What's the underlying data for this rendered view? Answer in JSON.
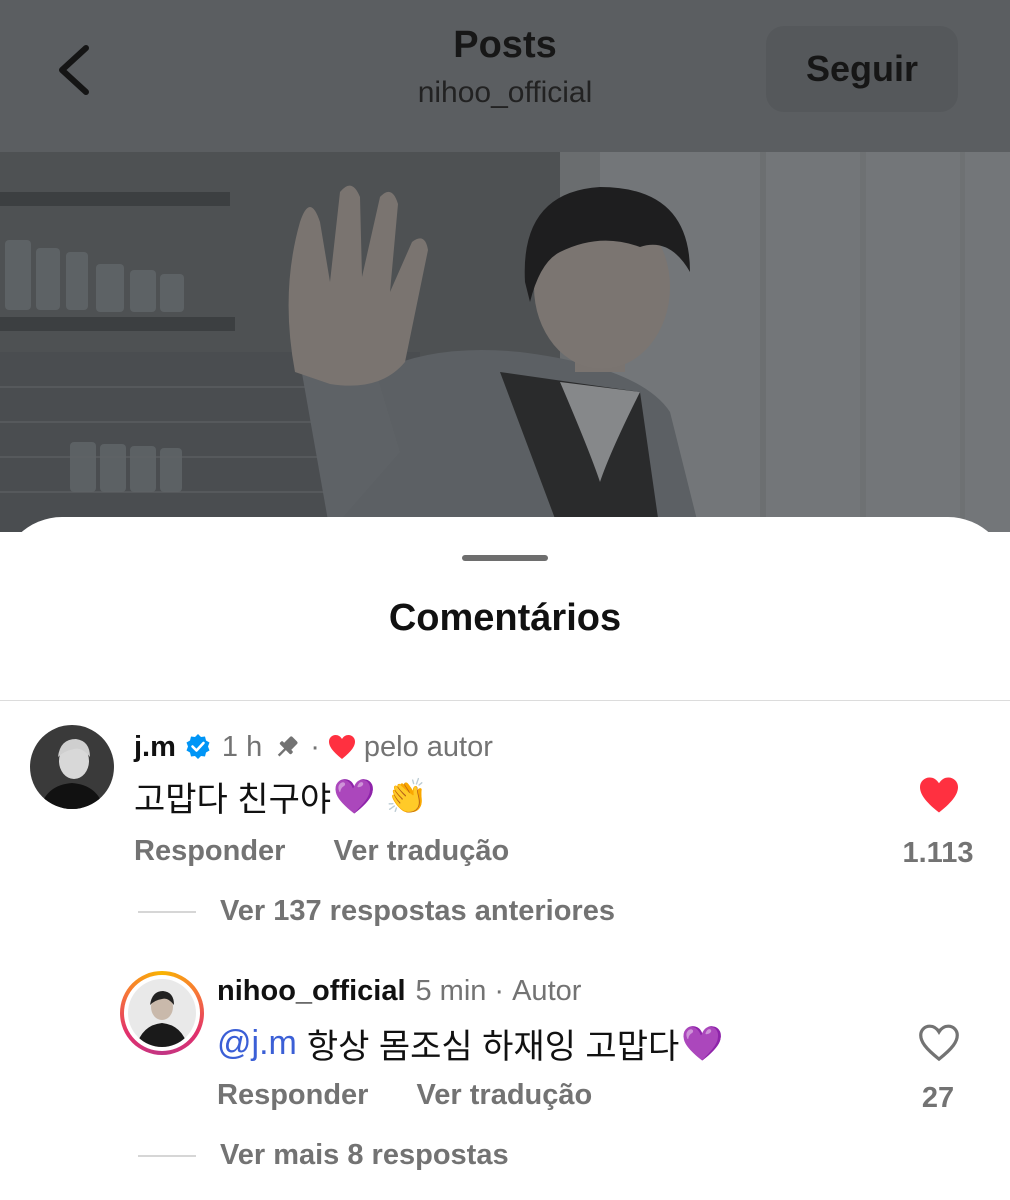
{
  "header": {
    "title": "Posts",
    "subtitle": "nihoo_official",
    "follow_label": "Seguir"
  },
  "sheet": {
    "title": "Comentários"
  },
  "comments": [
    {
      "username": "j.m",
      "verified": true,
      "time": "1 h",
      "pinned": true,
      "liked_by_author_label": "pelo autor",
      "text": "고맙다 친구야",
      "emojis": [
        "💜",
        "👏"
      ],
      "reply_label": "Responder",
      "translate_label": "Ver tradução",
      "liked": true,
      "like_count": "1.113",
      "replies_link": "Ver 137 respostas anteriores"
    },
    {
      "username": "nihoo_official",
      "time": "5 min",
      "author_label": "Autor",
      "mention": "@j.m",
      "text": "항상 몸조심 하재잉 고맙다",
      "emojis": [
        "💜"
      ],
      "reply_label": "Responder",
      "translate_label": "Ver tradução",
      "liked": false,
      "like_count": "27",
      "replies_link": "Ver mais 8 respostas"
    }
  ],
  "colors": {
    "header_dim": "#5b5e61",
    "verified_blue": "#0095f6",
    "like_red": "#ff3040",
    "mention_blue": "#3b5fd6",
    "muted_text": "#737373"
  }
}
